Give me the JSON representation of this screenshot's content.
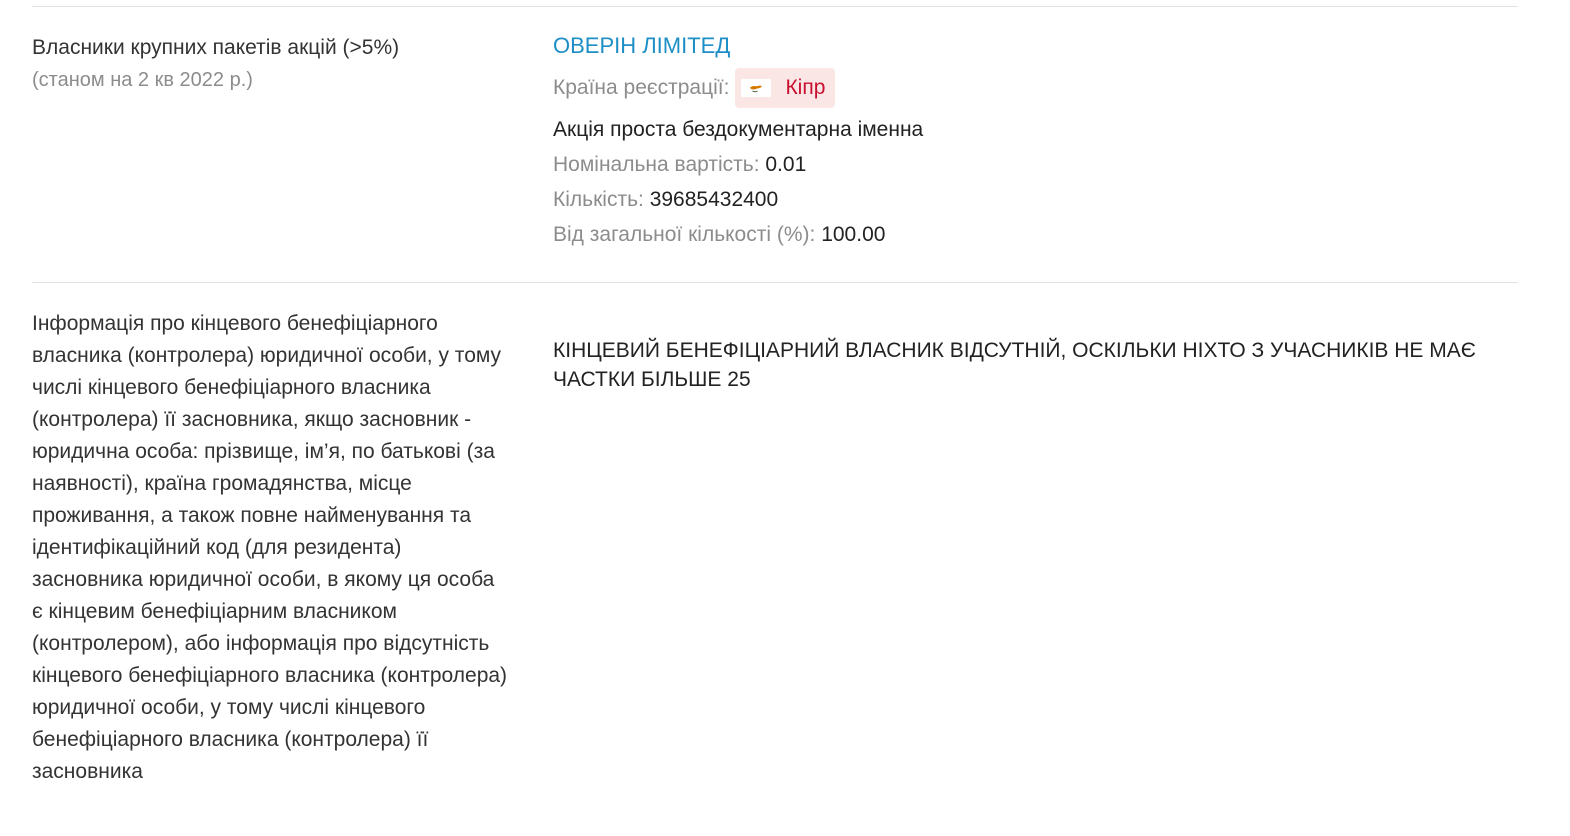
{
  "row1": {
    "label": "Власники крупних пакетів акцій (>5%)",
    "sublabel": "(станом на 2 кв 2022 р.)",
    "owner": {
      "name": "ОВЕРІН ЛІМІТЕД",
      "country_label": "Країна реєстрації:",
      "country": "Кіпр",
      "share_type": "Акція проста бездокументарна іменна",
      "nominal_label": "Номінальна вартість:",
      "nominal_value": "0.01",
      "qty_label": "Кількість:",
      "qty_value": "39685432400",
      "pct_label": "Від загальної кількості (%):",
      "pct_value": "100.00"
    }
  },
  "row2": {
    "label": "Інформація про кінцевого бенефіціарного власника (контролера) юридичної особи, у тому числі кінцевого бенефіціарного власника (контролера) її засновника, якщо засновник - юридична особа: прізвище, ім’я, по батькові (за наявності), країна громадянства, місце проживання, а також повне найменування та ідентифікаційний код (для резидента) засновника юридичної особи, в якому ця особа є кінцевим бенефіціарним власником (контролером), або інформація про відсутність кінцевого бенефіціарного власника (контролера) юридичної особи, у тому числі кінцевого бенефіціарного власника (контролера) її засновника",
    "value": "КІНЦЕВИЙ БЕНЕФІЦІАРНИЙ ВЛАСНИК ВІДСУТНІЙ, ОСКІЛЬКИ НІХТО З УЧАСНИКІВ НЕ МАЄ ЧАСТКИ БІЛЬШЕ 25"
  },
  "colors": {
    "link": "#1e8fc6",
    "muted": "#8c8c8c",
    "badge_bg": "#fbe6e6",
    "badge_text": "#c8102e"
  },
  "icons": {
    "country_flag": "cyprus-flag-icon"
  }
}
